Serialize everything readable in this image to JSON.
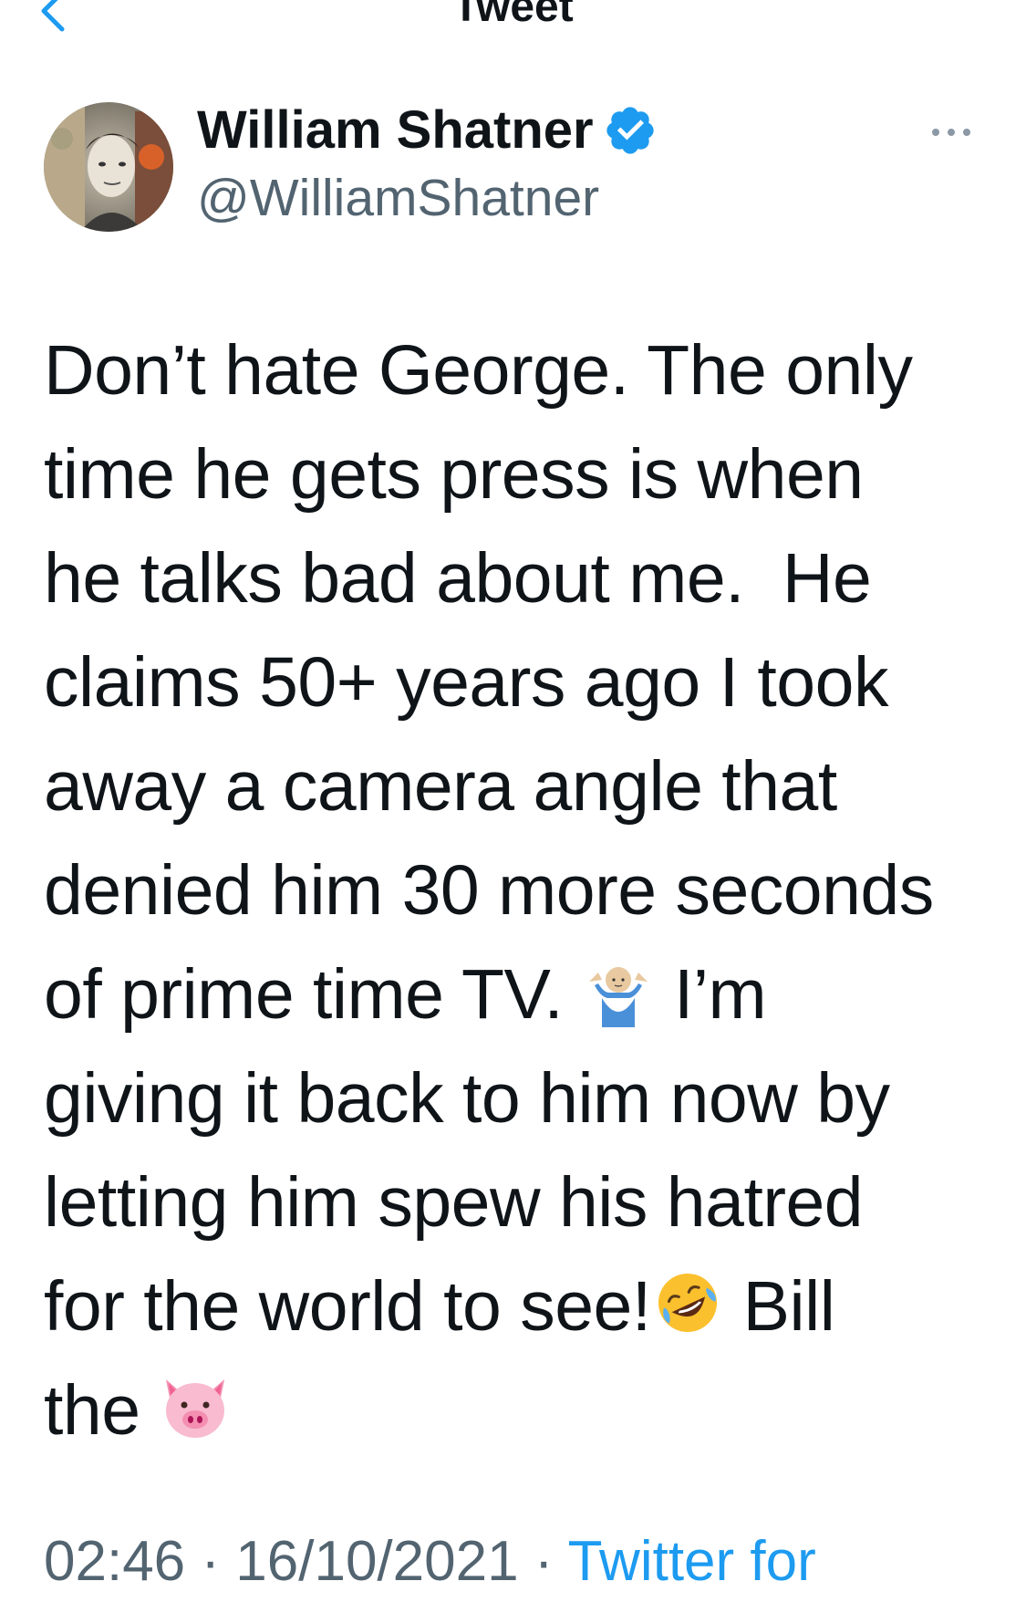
{
  "header": {
    "title": "Tweet",
    "back_icon": "chevron-left-icon"
  },
  "author": {
    "display_name": "William Shatner",
    "handle": "@WilliamShatner",
    "verified": true,
    "verified_icon": "verified-badge-icon"
  },
  "more_icon": "ellipsis-icon",
  "tweet": {
    "lines": [
      "Don’t hate George. The only",
      "time he gets press is when",
      "he talks bad about me.  He",
      "claims 50+ years ago I took",
      "away a camera angle that",
      "denied him 30 more seconds",
      "of prime time TV.",
      " I’m",
      "giving it back to him now by",
      "letting him spew his hatred",
      "for the world to see!",
      " Bill",
      "the"
    ],
    "emojis": [
      "person-shrugging-emoji",
      "rolling-on-floor-laughing-emoji",
      "pig-face-emoji"
    ]
  },
  "meta": {
    "time": "02:46",
    "separator": "·",
    "date": "16/10/2021",
    "source": "Twitter for"
  },
  "colors": {
    "accent": "#1d9bf0",
    "text": "#0f1419",
    "secondary": "#536471"
  }
}
